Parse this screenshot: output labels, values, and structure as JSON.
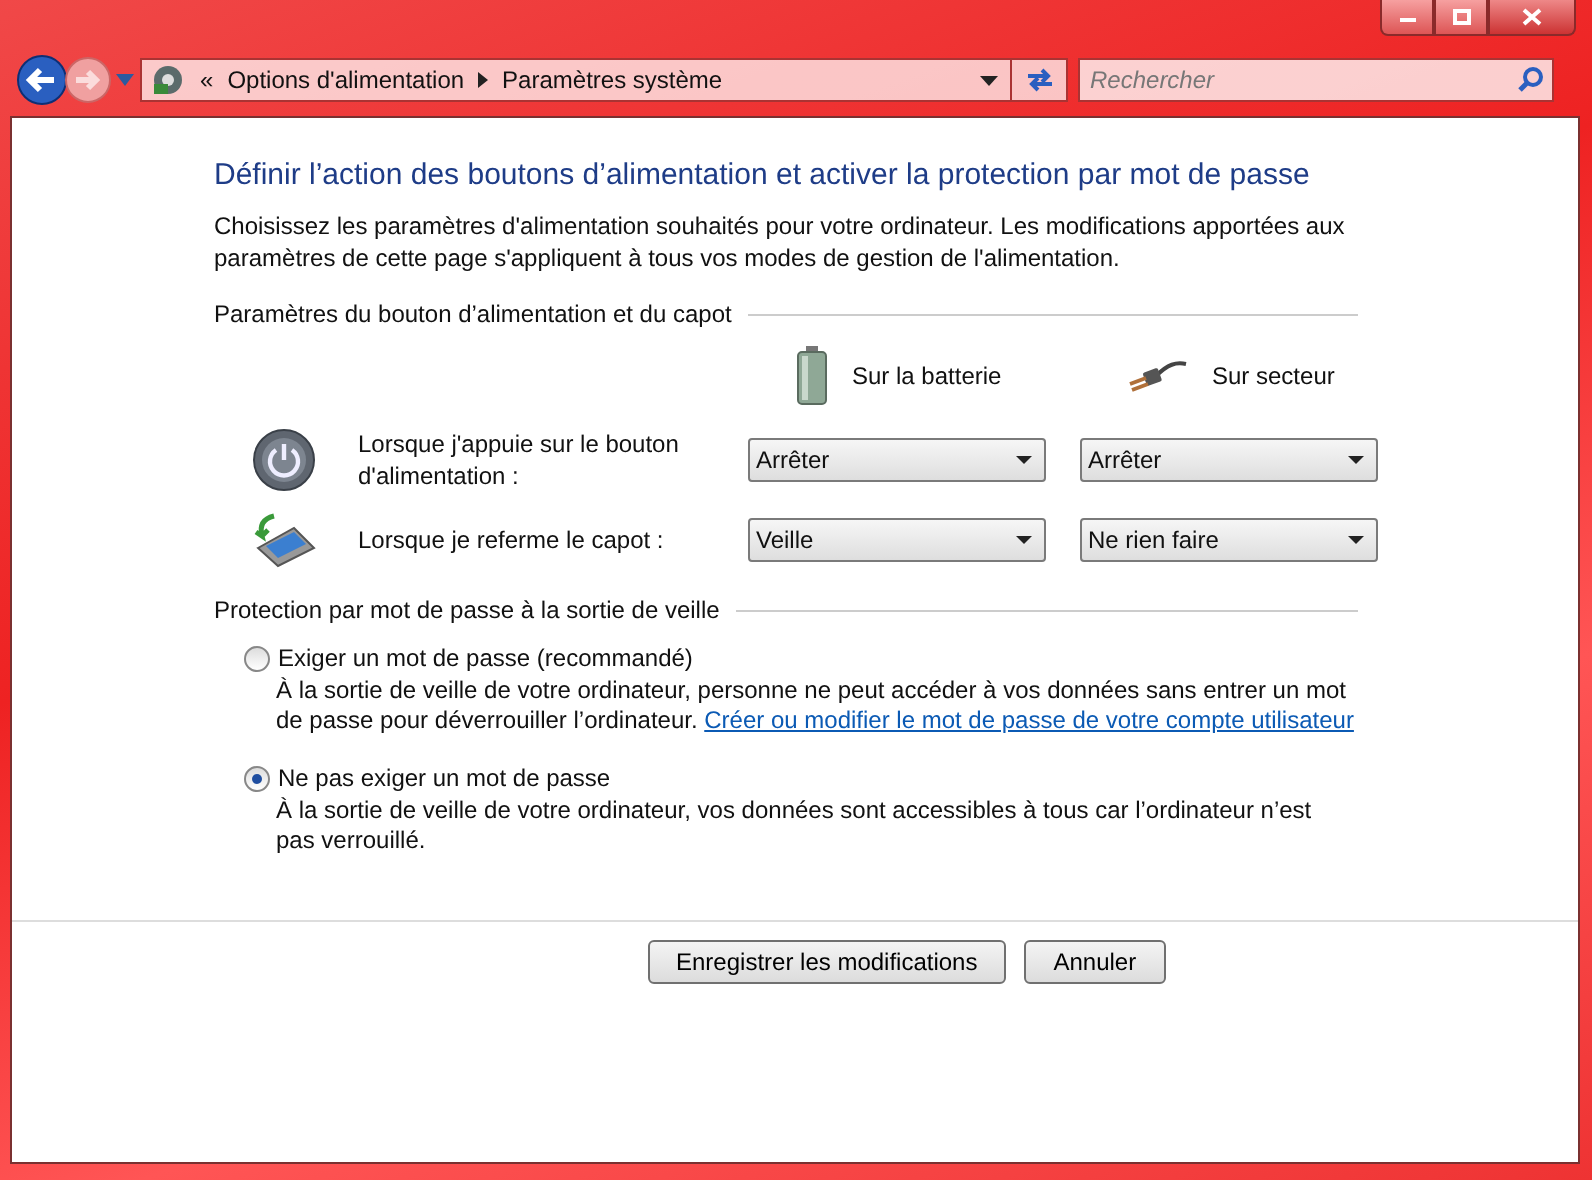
{
  "address_bar": {
    "overflow": "«",
    "breadcrumb": [
      "Options d'alimentation",
      "Paramètres système"
    ]
  },
  "search": {
    "placeholder": "Rechercher"
  },
  "title": "Définir l’action des boutons d’alimentation et activer la protection par mot de passe",
  "description": "Choisissez les paramètres d'alimentation souhaités pour votre ordinateur. Les modifications apportées aux paramètres de cette page s'appliquent à tous vos modes de gestion de l'alimentation.",
  "power_section": {
    "heading": "Paramètres du bouton d’alimentation et du capot",
    "columns": [
      {
        "label": "Sur la batterie",
        "kind": "battery"
      },
      {
        "label": "Sur secteur",
        "kind": "plug"
      }
    ],
    "rows": [
      {
        "label": "Lorsque j'appuie sur le bouton d'alimentation :",
        "kind": "power",
        "values": [
          "Arrêter",
          "Arrêter"
        ]
      },
      {
        "label": "Lorsque je referme le capot :",
        "kind": "lid",
        "values": [
          "Veille",
          "Ne rien faire"
        ]
      }
    ]
  },
  "password_section": {
    "heading": "Protection par mot de passe à la sortie de veille",
    "options": [
      {
        "label": "Exiger un mot de passe (recommandé)",
        "selected": false,
        "description": "À la sortie de veille de votre ordinateur, personne ne peut accéder à vos données sans entrer un mot de passe pour déverrouiller l’ordinateur.",
        "link": "Créer ou modifier le mot de passe de votre compte utilisateur"
      },
      {
        "label": "Ne pas exiger un mot de passe",
        "selected": true,
        "description": "À la sortie de veille de votre ordinateur, vos données sont accessibles à tous car l’ordinateur n’est pas verrouillé."
      }
    ]
  },
  "buttons": [
    "Enregistrer les modifications",
    "Annuler"
  ]
}
